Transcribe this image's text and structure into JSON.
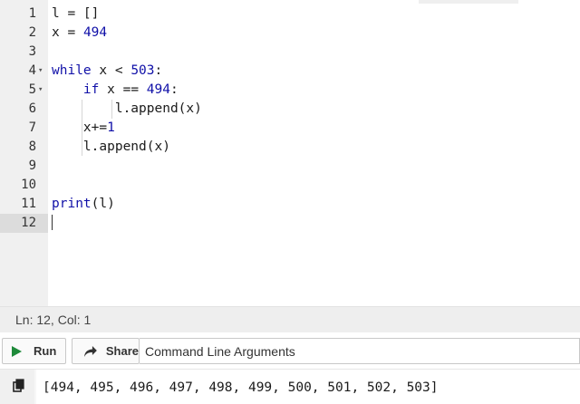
{
  "editor": {
    "lines": [
      {
        "num": "1",
        "fold": "",
        "code": "l = []"
      },
      {
        "num": "2",
        "fold": "",
        "code": "x = 494"
      },
      {
        "num": "3",
        "fold": "",
        "code": ""
      },
      {
        "num": "4",
        "fold": "▾",
        "code": "while x < 503:"
      },
      {
        "num": "5",
        "fold": "▾",
        "code": "    if x == 494:"
      },
      {
        "num": "6",
        "fold": "",
        "code": "        l.append(x)"
      },
      {
        "num": "7",
        "fold": "",
        "code": "    x+=1"
      },
      {
        "num": "8",
        "fold": "",
        "code": "    l.append(x)"
      },
      {
        "num": "9",
        "fold": "",
        "code": ""
      },
      {
        "num": "10",
        "fold": "",
        "code": ""
      },
      {
        "num": "11",
        "fold": "",
        "code": "print(l)"
      },
      {
        "num": "12",
        "fold": "",
        "code": ""
      }
    ],
    "active_line": "12"
  },
  "status": {
    "text": "Ln: 12,  Col: 1"
  },
  "toolbar": {
    "run_label": "Run",
    "run_icon": "play-icon",
    "share_label": "Share",
    "share_icon": "share-arrow-icon",
    "args_placeholder": "Command Line Arguments"
  },
  "output": {
    "copy_icon": "copy-icon",
    "text": "[494, 495, 496, 497, 498, 499, 500, 501, 502, 503]"
  },
  "colors": {
    "keyword": "#1010a8",
    "run_icon": "#1e8a3a",
    "gutter": "#f0f0f0"
  }
}
